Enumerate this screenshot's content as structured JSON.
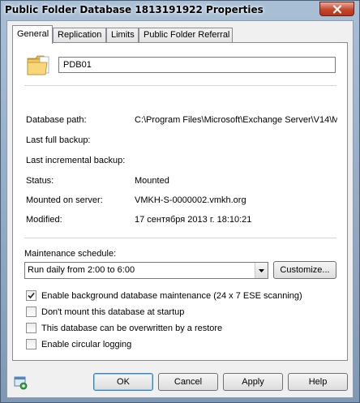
{
  "window": {
    "title": "Public Folder Database 1813191922 Properties"
  },
  "tabs": [
    {
      "label": "General",
      "active": true
    },
    {
      "label": "Replication",
      "active": false
    },
    {
      "label": "Limits",
      "active": false
    },
    {
      "label": "Public Folder Referral",
      "active": false
    }
  ],
  "general": {
    "name_value": "PDB01",
    "properties": [
      {
        "label": "Database path:",
        "value": "C:\\Program Files\\Microsoft\\Exchange Server\\V14\\M"
      },
      {
        "label": "Last full backup:",
        "value": ""
      },
      {
        "label": "Last incremental backup:",
        "value": ""
      },
      {
        "label": "Status:",
        "value": "Mounted"
      },
      {
        "label": "Mounted on server:",
        "value": "VMKH-S-0000002.vmkh.org"
      },
      {
        "label": "Modified:",
        "value": "17 сентября 2013 г. 18:10:21"
      }
    ],
    "maintenance_label": "Maintenance schedule:",
    "maintenance_selected": "Run daily from 2:00 to 6:00",
    "customize_label": "Customize...",
    "checkboxes": [
      {
        "label": "Enable background database maintenance (24 x 7 ESE scanning)",
        "checked": true
      },
      {
        "label": "Don't mount this database at startup",
        "checked": false
      },
      {
        "label": "This database can be overwritten by a restore",
        "checked": false
      },
      {
        "label": "Enable circular logging",
        "checked": false
      }
    ]
  },
  "buttons": {
    "ok": "OK",
    "cancel": "Cancel",
    "apply": "Apply",
    "help": "Help"
  },
  "icons": {
    "close": "close-icon",
    "folder": "folder-icon",
    "dropdown": "chevron-down-icon",
    "check": "checkmark-icon",
    "help_context": "help-context-icon"
  },
  "colors": {
    "titlebar": "#a9bfd6",
    "close_button": "#c4472b",
    "dialog_bg": "#f0f0f0",
    "panel_bg": "#ffffff"
  }
}
